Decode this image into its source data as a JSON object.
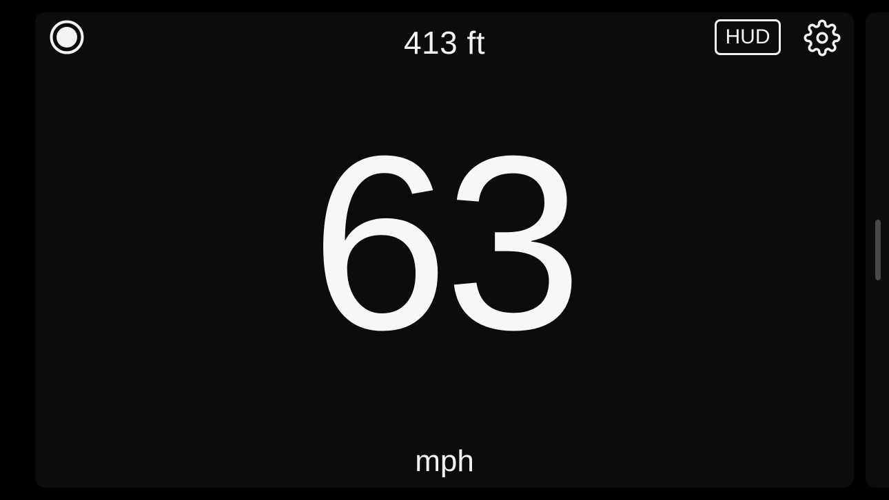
{
  "header": {
    "altitude_value": "413 ft",
    "hud_label": "HUD"
  },
  "speedometer": {
    "speed_value": "63",
    "unit_label": "mph"
  },
  "icons": {
    "record": "record-icon",
    "settings": "gear-icon"
  },
  "colors": {
    "background": "#000000",
    "card": "#0c0c0c",
    "foreground": "#f2f2f2",
    "scrollbar": "#4a4a4a"
  }
}
